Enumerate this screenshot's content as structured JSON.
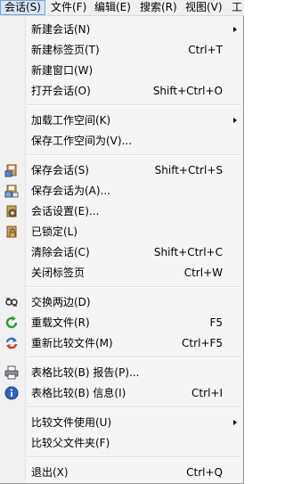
{
  "menubar": {
    "items": [
      {
        "label": "会话(S)"
      },
      {
        "label": "文件(F)"
      },
      {
        "label": "编辑(E)"
      },
      {
        "label": "搜索(R)"
      },
      {
        "label": "视图(V)"
      },
      {
        "label": "工"
      }
    ]
  },
  "menu": {
    "new_session": {
      "label": "新建会话(N)"
    },
    "new_tab": {
      "label": "新建标签页(T)",
      "shortcut": "Ctrl+T"
    },
    "new_window": {
      "label": "新建窗口(W)"
    },
    "open_session": {
      "label": "打开会话(O)",
      "shortcut": "Shift+Ctrl+O"
    },
    "load_workspace": {
      "label": "加载工作空间(K)"
    },
    "save_workspace_as": {
      "label": "保存工作空间为(V)..."
    },
    "save_session": {
      "label": "保存会话(S)",
      "shortcut": "Shift+Ctrl+S",
      "icon": "save-icon"
    },
    "save_session_as": {
      "label": "保存会话为(A)...",
      "icon": "save-as-icon"
    },
    "session_settings": {
      "label": "会话设置(E)...",
      "icon": "settings-icon"
    },
    "locked": {
      "label": "已锁定(L)",
      "icon": "lock-icon"
    },
    "clear_session": {
      "label": "清除会话(C)",
      "shortcut": "Shift+Ctrl+C"
    },
    "close_tab": {
      "label": "关闭标签页",
      "shortcut": "Ctrl+W"
    },
    "swap_sides": {
      "label": "交换两边(D)",
      "icon": "swap-icon"
    },
    "reload_file": {
      "label": "重载文件(R)",
      "shortcut": "F5",
      "icon": "reload-icon"
    },
    "recompare": {
      "label": "重新比较文件(M)",
      "shortcut": "Ctrl+F5",
      "icon": "recompare-icon"
    },
    "report": {
      "label": "表格比较(B) 报告(P)...",
      "icon": "print-icon"
    },
    "info": {
      "label": "表格比较(B) 信息(I)",
      "shortcut": "Ctrl+I",
      "icon": "info-icon"
    },
    "compare_using": {
      "label": "比较文件使用(U)"
    },
    "compare_parent": {
      "label": "比较父文件夹(F)"
    },
    "exit": {
      "label": "退出(X)",
      "shortcut": "Ctrl+Q"
    }
  }
}
